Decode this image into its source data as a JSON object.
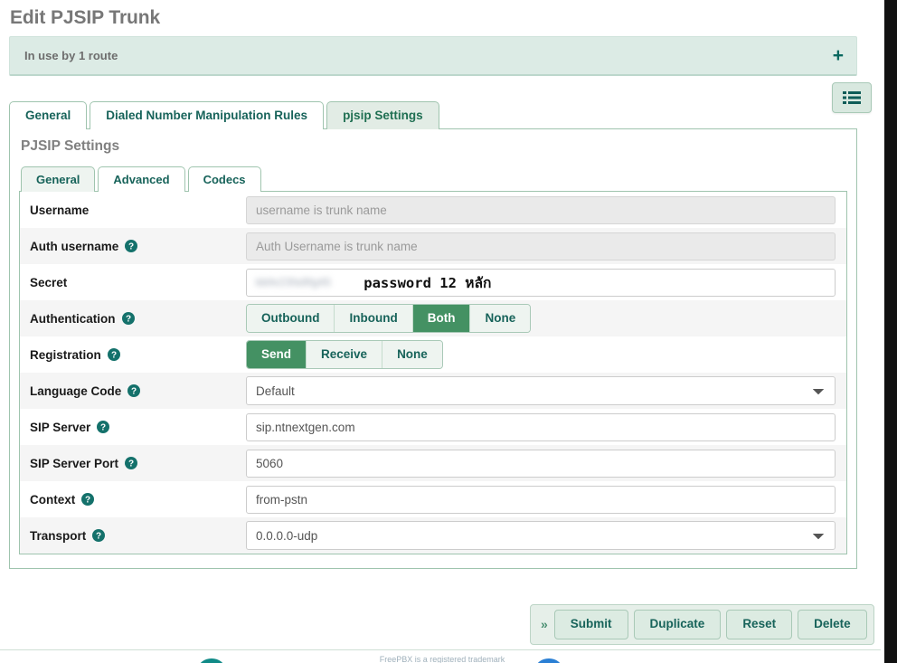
{
  "page": {
    "title": "Edit PJSIP Trunk"
  },
  "banner": {
    "text": "In use by 1 route",
    "plus": "+",
    "plus_icon": "plus-icon"
  },
  "toolbar": {
    "list_icon": "list-icon"
  },
  "outer_tabs": [
    {
      "label": "General",
      "active": false
    },
    {
      "label": "Dialed Number Manipulation Rules",
      "active": false
    },
    {
      "label": "pjsip Settings",
      "active": true
    }
  ],
  "panel": {
    "heading": "PJSIP Settings"
  },
  "inner_tabs": [
    {
      "label": "General",
      "active": true
    },
    {
      "label": "Advanced",
      "active": false
    },
    {
      "label": "Codecs",
      "active": false
    }
  ],
  "fields": {
    "username": {
      "label": "Username",
      "value": "",
      "placeholder": "username is trunk name",
      "help": false
    },
    "auth_username": {
      "label": "Auth username",
      "value": "",
      "placeholder": "Auth Username is trunk name",
      "help": true
    },
    "secret": {
      "label": "Secret",
      "masked_value": "bbfe23fa9fg45",
      "note": "password 12 หลัก",
      "help": false
    },
    "authentication": {
      "label": "Authentication",
      "help": true,
      "options": [
        "Outbound",
        "Inbound",
        "Both",
        "None"
      ],
      "selected": "Both"
    },
    "registration": {
      "label": "Registration",
      "help": true,
      "options": [
        "Send",
        "Receive",
        "None"
      ],
      "selected": "Send"
    },
    "language_code": {
      "label": "Language Code",
      "help": true,
      "value": "Default",
      "options": [
        "Default"
      ]
    },
    "sip_server": {
      "label": "SIP Server",
      "help": true,
      "value": "sip.ntnextgen.com"
    },
    "sip_server_port": {
      "label": "SIP Server Port",
      "help": true,
      "value": "5060"
    },
    "context": {
      "label": "Context",
      "help": true,
      "value": "from-pstn"
    },
    "transport": {
      "label": "Transport",
      "help": true,
      "value": "0.0.0.0-udp",
      "options": [
        "0.0.0.0-udp"
      ]
    }
  },
  "actions": {
    "expand": "»",
    "submit": "Submit",
    "duplicate": "Duplicate",
    "reset": "Reset",
    "delete": "Delete"
  },
  "footer": {
    "text": "FreePBX is a registered trademark"
  },
  "colors": {
    "accent_green": "#449163",
    "tab_text": "#17635a",
    "banner_bg": "#dcebe5",
    "help_icon": "#14716b"
  }
}
